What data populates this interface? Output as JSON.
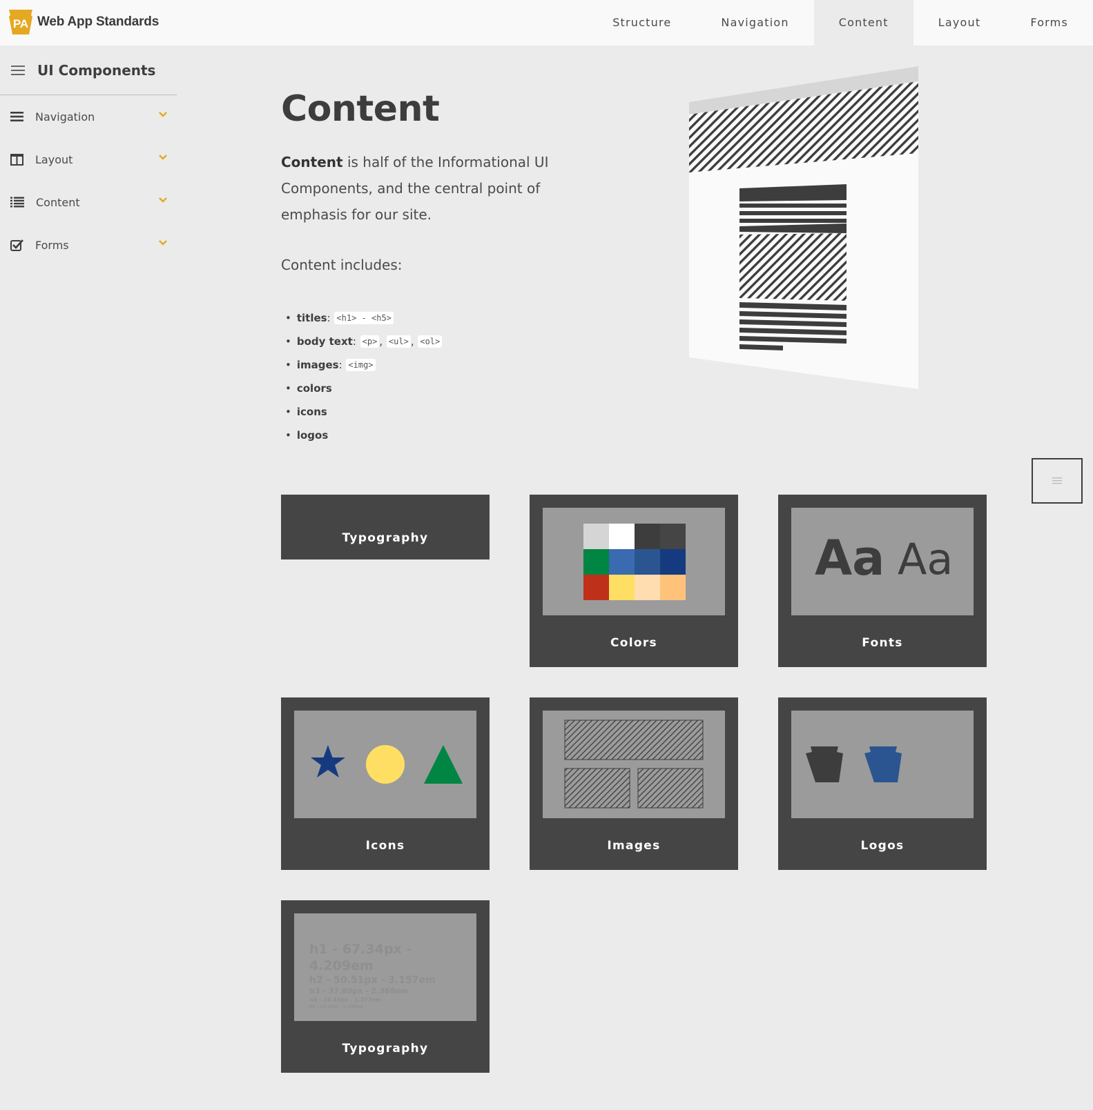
{
  "header": {
    "brand_name": "Web App Standards",
    "brand_logo_text": "PA",
    "nav": [
      {
        "label": "Structure",
        "active": false
      },
      {
        "label": "Navigation",
        "active": false
      },
      {
        "label": "Content",
        "active": true
      },
      {
        "label": "Layout",
        "active": false
      },
      {
        "label": "Forms",
        "active": false
      }
    ]
  },
  "sidebar": {
    "title": "UI Components",
    "items": [
      {
        "label": "Navigation",
        "icon": "bars-icon"
      },
      {
        "label": "Layout",
        "icon": "columns-icon"
      },
      {
        "label": "Content",
        "icon": "list-icon"
      },
      {
        "label": "Forms",
        "icon": "checkbox-icon"
      }
    ]
  },
  "main": {
    "title": "Content",
    "intro_strong": "Content",
    "intro_rest": " is half of the Informational UI Components, and the central point of emphasis for our site.",
    "includes_heading": "Content includes:",
    "bullets": [
      {
        "term": "titles",
        "codes": [
          "<h1> - <h5>"
        ]
      },
      {
        "term": "body text",
        "codes": [
          "<p>",
          "<ul>",
          "<ol>"
        ]
      },
      {
        "term": "images",
        "codes": [
          "<img>"
        ]
      },
      {
        "term": "colors",
        "codes": []
      },
      {
        "term": "icons",
        "codes": []
      },
      {
        "term": "logos",
        "codes": []
      }
    ]
  },
  "cards": [
    {
      "label": "Typography"
    },
    {
      "label": "Colors"
    },
    {
      "label": "Fonts"
    },
    {
      "label": "Icons"
    },
    {
      "label": "Images"
    },
    {
      "label": "Logos"
    },
    {
      "label": "Typography"
    }
  ],
  "previews": {
    "fonts_sample_1": "Aa",
    "fonts_sample_2": "Aa",
    "typo_h1": "h1 - 67.34px - 4.209em",
    "typo_h2": "h2 - 50.51px - 3.157em",
    "typo_h3": "h3 - 37.89px - 2.368em",
    "typo_h4": "h4 - 28.43px - 1.777em",
    "typo_h5": "h5 - 21.33px - 1.333em"
  },
  "colors": {
    "accent": "#e5a823",
    "dark": "#454545",
    "swatches": [
      "#d5d5d5",
      "#ffffff",
      "#3d3d3d",
      "#454545",
      "#008542",
      "#3a6ab0",
      "#2a5590",
      "#153a80",
      "#bf301b",
      "#ffdf63",
      "#ffddb0",
      "#ffc27a"
    ],
    "icon_star": "#153a80",
    "icon_circle": "#ffdf63",
    "icon_triangle": "#008542",
    "logo_dark": "#3d3d3d",
    "logo_blue": "#2a5590"
  }
}
